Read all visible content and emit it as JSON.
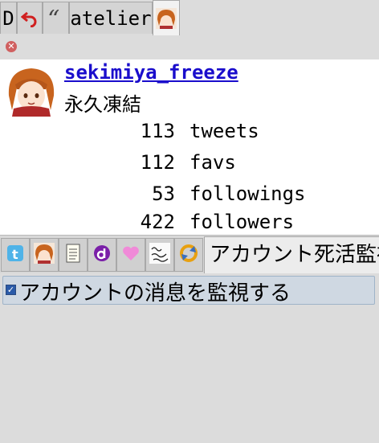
{
  "top_tabs": {
    "d_label": "D",
    "atelier_label": "atelier"
  },
  "profile": {
    "screen_name": "sekimiya_freeze",
    "display_name": "永久凍結",
    "stats": [
      {
        "count": "113",
        "label": "tweets"
      },
      {
        "count": "112",
        "label": "favs"
      },
      {
        "count": "53",
        "label": "followings"
      },
      {
        "count": "422",
        "label": "followers"
      }
    ]
  },
  "services": {
    "icons": [
      "twitter-icon",
      "avatar-icon",
      "notepad-icon",
      "d-icon",
      "heart-icon",
      "handwriting-icon",
      "refresh-icon"
    ],
    "title": "アカウント死活監視"
  },
  "panel": {
    "checkbox_label": "アカウントの消息を監視する",
    "checked": true
  },
  "colors": {
    "link": "#1a0dcc",
    "checkbox": "#2a5aa8"
  }
}
